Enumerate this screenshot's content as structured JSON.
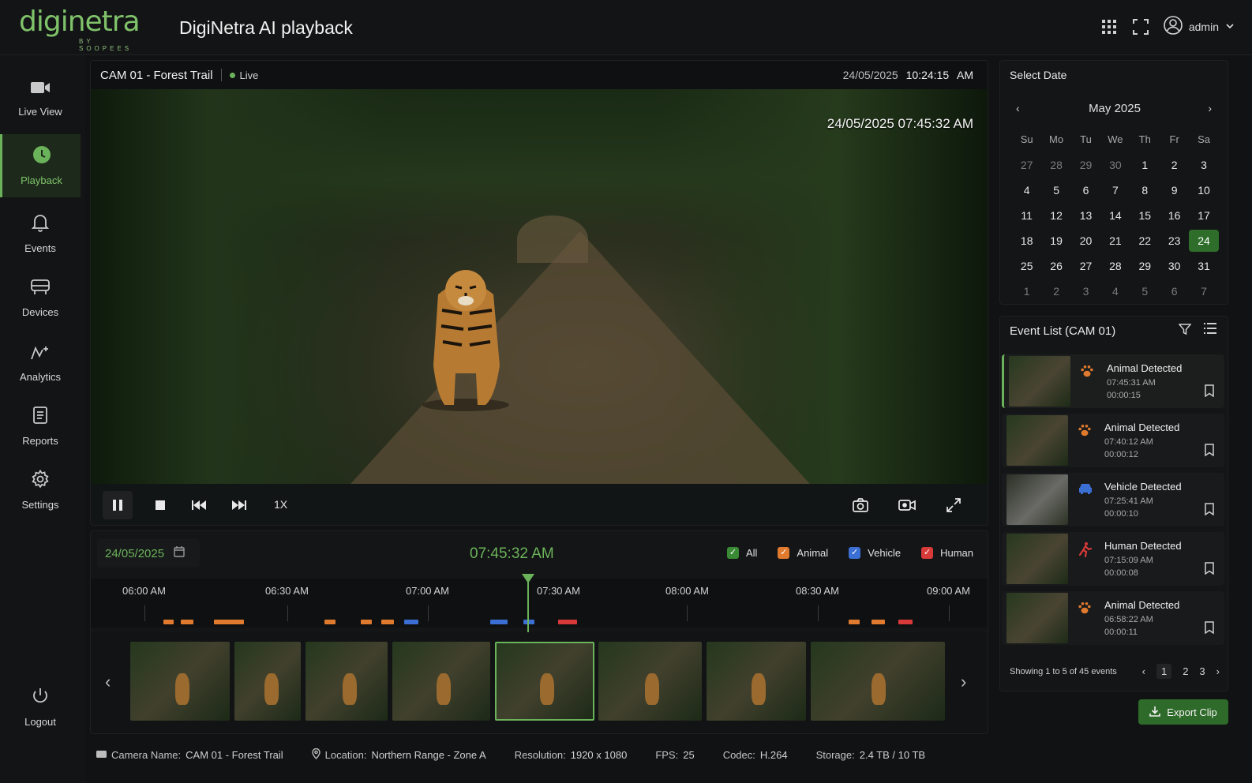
{
  "brand": {
    "logo_text": "diginetra",
    "logo_sub": "BY SOOPEES"
  },
  "app_title": "DigiNetra AI playback",
  "user": {
    "name": "admin"
  },
  "sidebar": {
    "items": [
      {
        "label": "Live View",
        "icon": "video-camera-icon",
        "active": false
      },
      {
        "label": "Playback",
        "icon": "playback-icon",
        "active": true
      },
      {
        "label": "Events",
        "icon": "bell-icon",
        "active": false
      },
      {
        "label": "Devices",
        "icon": "devices-icon",
        "active": false
      },
      {
        "label": "Analytics",
        "icon": "analytics-icon",
        "active": false
      },
      {
        "label": "Reports",
        "icon": "reports-icon",
        "active": false
      },
      {
        "label": "Settings",
        "icon": "gear-icon",
        "active": false
      }
    ],
    "logout_label": "Logout"
  },
  "video": {
    "camera_title": "CAM 01 - Forest Trail",
    "live_label": "Live",
    "header_date": "24/05/2025",
    "header_time": "10:24:15",
    "header_ampm": "AM",
    "overlay_timestamp": "24/05/2025  07:45:32 AM",
    "speed": "1X"
  },
  "timeline": {
    "date": "24/05/2025",
    "current_time": "07:45:32 AM",
    "filters": [
      {
        "label": "All",
        "color": "#3a8a35",
        "checked": true
      },
      {
        "label": "Animal",
        "color": "#e07a2e",
        "checked": true
      },
      {
        "label": "Vehicle",
        "color": "#3b6fd4",
        "checked": true
      },
      {
        "label": "Human",
        "color": "#d83a3a",
        "checked": true
      }
    ],
    "tick_labels": [
      "06:00 AM",
      "06:30 AM",
      "07:00 AM",
      "07:30 AM",
      "08:00 AM",
      "08:30 AM",
      "09:00 AM"
    ]
  },
  "calendar": {
    "title": "Select Date",
    "month_label": "May 2025",
    "dow": [
      "Su",
      "Mo",
      "Tu",
      "We",
      "Th",
      "Fr",
      "Sa"
    ],
    "weeks": [
      [
        "27",
        "28",
        "29",
        "30",
        "1",
        "2",
        "3"
      ],
      [
        "4",
        "5",
        "6",
        "7",
        "8",
        "9",
        "10"
      ],
      [
        "11",
        "12",
        "13",
        "14",
        "15",
        "16",
        "17"
      ],
      [
        "18",
        "19",
        "20",
        "21",
        "22",
        "23",
        "24"
      ],
      [
        "25",
        "26",
        "27",
        "28",
        "29",
        "30",
        "31"
      ],
      [
        "1",
        "2",
        "3",
        "4",
        "5",
        "6",
        "7"
      ]
    ],
    "selected_day": "24"
  },
  "events": {
    "title": "Event List (CAM 01)",
    "items": [
      {
        "name": "Animal Detected",
        "time": "07:45:31 AM",
        "duration": "00:00:15",
        "type": "animal",
        "active": true
      },
      {
        "name": "Animal Detected",
        "time": "07:40:12 AM",
        "duration": "00:00:12",
        "type": "animal",
        "active": false
      },
      {
        "name": "Vehicle Detected",
        "time": "07:25:41 AM",
        "duration": "00:00:10",
        "type": "vehicle",
        "active": false
      },
      {
        "name": "Human Detected",
        "time": "07:15:09 AM",
        "duration": "00:00:08",
        "type": "human",
        "active": false
      },
      {
        "name": "Animal Detected",
        "time": "06:58:22 AM",
        "duration": "00:00:11",
        "type": "animal",
        "active": false
      }
    ],
    "footer": "Showing 1 to 5 of 45 events",
    "pages": [
      "1",
      "2",
      "3"
    ],
    "current_page": "1",
    "export_label": "Export Clip"
  },
  "status": {
    "camera_name_label": "Camera Name:",
    "camera_name": "CAM 01 - Forest Trail",
    "location_label": "Location:",
    "location": "Northern Range - Zone A",
    "resolution_label": "Resolution:",
    "resolution": "1920 x 1080",
    "fps_label": "FPS:",
    "fps": "25",
    "codec_label": "Codec:",
    "codec": "H.264",
    "storage_label": "Storage:",
    "storage": "2.4 TB / 10 TB"
  },
  "colors": {
    "accent": "#6bb35a",
    "animal": "#e07a2e",
    "vehicle": "#3b6fd4",
    "human": "#d83a3a"
  }
}
